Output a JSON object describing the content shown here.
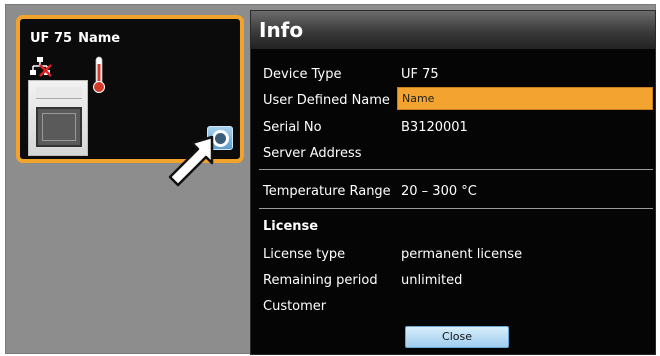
{
  "device_card": {
    "model": "UF 75",
    "name": "Name",
    "icons": [
      "network-disconnected-icon",
      "thermometer-icon",
      "info-icon",
      "pointer-arrow-icon"
    ]
  },
  "dialog": {
    "title": "Info",
    "device_type_label": "Device Type",
    "device_type_value": "UF 75",
    "user_name_label": "User Defined Name",
    "user_name_value": "Name",
    "serial_label": "Serial No",
    "serial_value": "B3120001",
    "server_label": "Server Address",
    "temp_label": "Temperature Range",
    "temp_value": "20 – 300 °C",
    "license_title": "License",
    "license_type_label": "License type",
    "license_type_value": "permanent license",
    "remaining_label": "Remaining period",
    "remaining_value": "unlimited",
    "customer_label": "Customer",
    "close_label": "Close"
  },
  "colors": {
    "accent": "#f2a32c",
    "field_bg": "#f2a330",
    "button_bg": "#9fcdef",
    "dialog_bg": "#050505",
    "stage_bg": "#8d8d8d"
  }
}
